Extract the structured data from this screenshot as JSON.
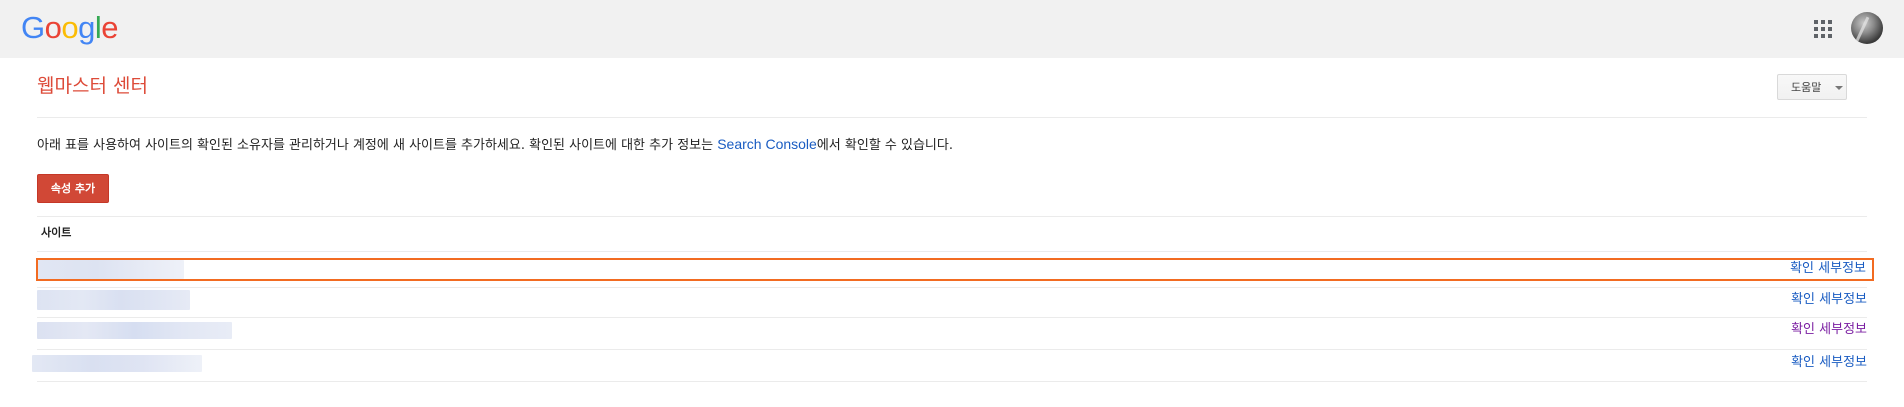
{
  "header": {
    "logo_letters": [
      {
        "char": "G",
        "color": "#4285f4"
      },
      {
        "char": "o",
        "color": "#ea4335"
      },
      {
        "char": "o",
        "color": "#fbbc05"
      },
      {
        "char": "g",
        "color": "#4285f4"
      },
      {
        "char": "l",
        "color": "#34a853"
      },
      {
        "char": "e",
        "color": "#ea4335"
      }
    ],
    "apps_icon": "apps-grid-icon",
    "avatar_icon": "user-avatar"
  },
  "page": {
    "title": "웹마스터 센터",
    "help_label": "도움말",
    "intro_before": "아래 표를 사용하여 사이트의 확인된 소유자를 관리하거나 계정에 새 사이트를 추가하세요. 확인된 사이트에 대한 추가 정보는 ",
    "intro_link": "Search Console",
    "intro_after": "에서 확인할 수 있습니다.",
    "add_property_label": "속성 추가",
    "column_header": "사이트"
  },
  "sites": [
    {
      "url": "",
      "details_label": "확인 세부정보",
      "link_color": "#1a5cc2",
      "selected": true
    },
    {
      "url": "",
      "details_label": "확인 세부정보",
      "link_color": "#1a5cc2",
      "selected": false
    },
    {
      "url": "",
      "details_label": "확인 세부정보",
      "link_color": "#7b1fa2",
      "selected": false
    },
    {
      "url": "",
      "details_label": "확인 세부정보",
      "link_color": "#1a5cc2",
      "selected": false
    }
  ],
  "colors": {
    "accent_red": "#dd4b39",
    "button_red": "#d14836",
    "link_blue": "#1a5cc2",
    "visited_purple": "#7b1fa2",
    "selection_orange": "#f26b21",
    "topbar_gray": "#f1f1f1"
  }
}
